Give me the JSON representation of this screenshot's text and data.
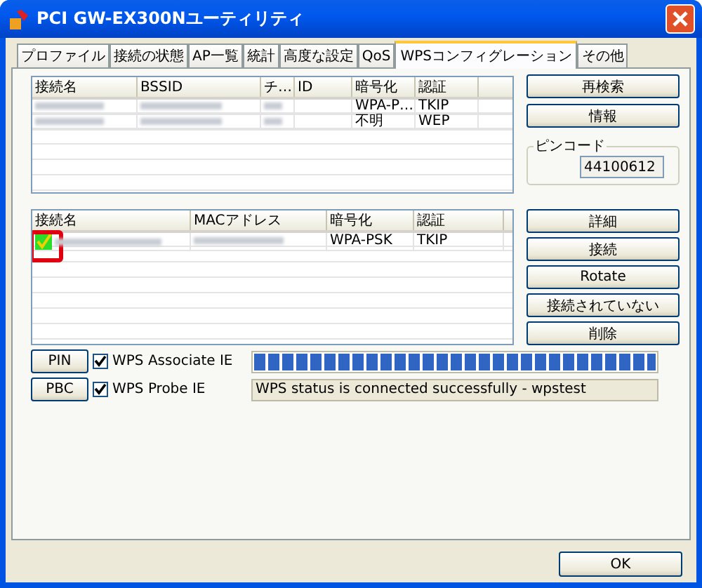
{
  "window": {
    "title": "PCI GW-EX300Nユーティリティ"
  },
  "tabs": [
    {
      "label": "プロファイル",
      "selected": false
    },
    {
      "label": "接続の状態",
      "selected": false
    },
    {
      "label": "AP一覧",
      "selected": false
    },
    {
      "label": "統計",
      "selected": false
    },
    {
      "label": "高度な設定",
      "selected": false
    },
    {
      "label": "QoS",
      "selected": false
    },
    {
      "label": "WPSコンフィグレーション",
      "selected": true
    },
    {
      "label": "その他",
      "selected": false
    }
  ],
  "ap_list": {
    "columns": [
      "接続名",
      "BSSID",
      "チ…",
      "ID",
      "暗号化",
      "認証"
    ],
    "rows": [
      {
        "cells": [
          {
            "kind": "redacted"
          },
          {
            "kind": "redacted"
          },
          {
            "kind": "redacted"
          },
          {
            "kind": "empty"
          },
          {
            "kind": "text",
            "text": "WPA-P…"
          },
          {
            "kind": "text",
            "text": "TKIP"
          }
        ]
      },
      {
        "cells": [
          {
            "kind": "redacted"
          },
          {
            "kind": "redacted"
          },
          {
            "kind": "redacted"
          },
          {
            "kind": "empty"
          },
          {
            "kind": "text",
            "text": "不明"
          },
          {
            "kind": "text",
            "text": "WEP"
          }
        ]
      }
    ]
  },
  "side_buttons_top": [
    "再検索",
    "情報"
  ],
  "pin_code": {
    "label": "ピンコード",
    "value": "44100612"
  },
  "profile_list": {
    "columns": [
      "接続名",
      "MACアドレス",
      "暗号化",
      "認証"
    ],
    "rows": [
      {
        "connected": true,
        "marked": true,
        "cells": [
          {
            "kind": "redacted"
          },
          {
            "kind": "redacted"
          },
          {
            "kind": "text",
            "text": "WPA-PSK"
          },
          {
            "kind": "text",
            "text": "TKIP"
          }
        ]
      }
    ]
  },
  "side_buttons_bottom": [
    "詳細",
    "接続",
    "Rotate",
    "接続されていない",
    "削除"
  ],
  "wps_rows": [
    {
      "button": "PIN",
      "checkbox": {
        "label": "WPS Associate IE",
        "checked": true
      }
    },
    {
      "button": "PBC",
      "checkbox": {
        "label": "WPS Probe IE",
        "checked": true
      }
    }
  ],
  "progress": {
    "level": 1
  },
  "status": "WPS status is connected successfully - wpstest",
  "ok_button": "OK"
}
